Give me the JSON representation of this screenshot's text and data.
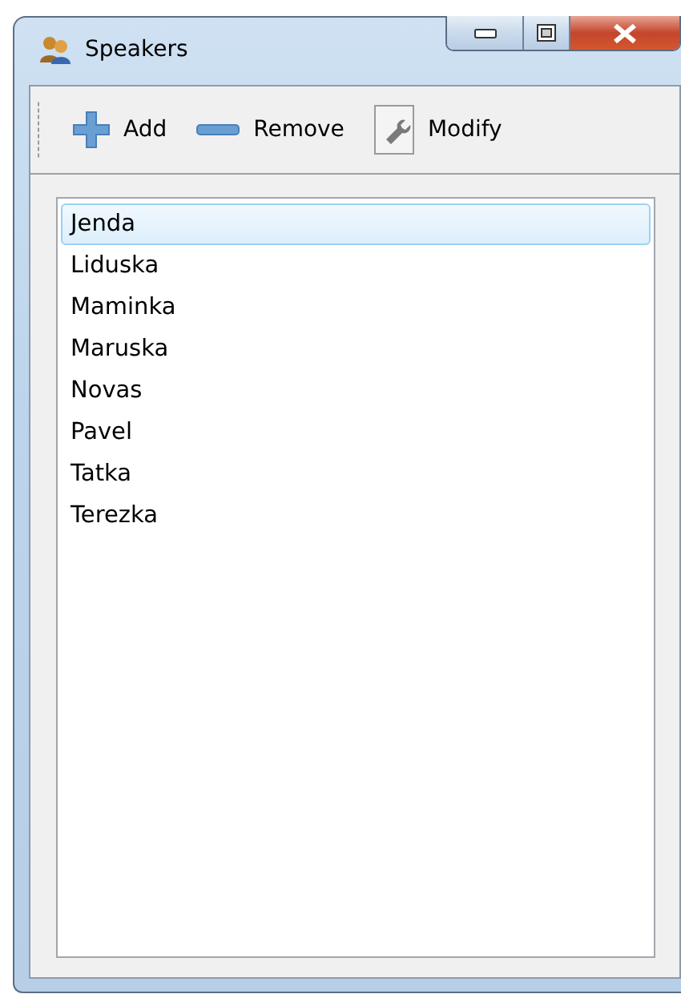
{
  "window": {
    "title": "Speakers"
  },
  "toolbar": [
    {
      "kind": "add",
      "label": "Add"
    },
    {
      "kind": "remove",
      "label": "Remove"
    },
    {
      "kind": "modify",
      "label": "Modify"
    }
  ],
  "speakers": [
    {
      "name": "Jenda",
      "selected": true
    },
    {
      "name": "Liduska",
      "selected": false
    },
    {
      "name": "Maminka",
      "selected": false
    },
    {
      "name": "Maruska",
      "selected": false
    },
    {
      "name": "Novas",
      "selected": false
    },
    {
      "name": "Pavel",
      "selected": false
    },
    {
      "name": "Tatka",
      "selected": false
    },
    {
      "name": "Terezka",
      "selected": false
    }
  ]
}
